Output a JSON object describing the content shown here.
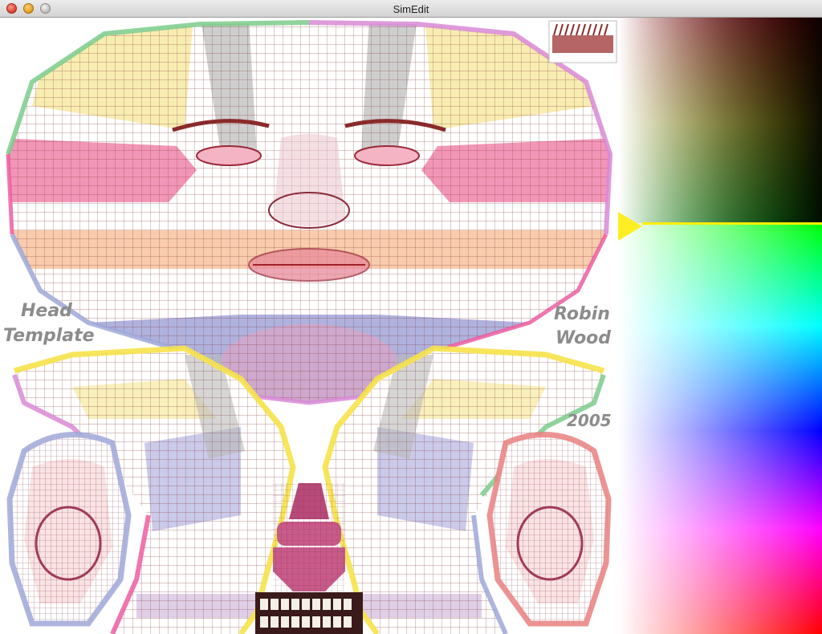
{
  "window": {
    "title": "SimEdit"
  },
  "texture_labels": {
    "head": "Head",
    "template": "Template",
    "robin": "Robin",
    "wood": "Wood",
    "year": "2005"
  },
  "colors": {
    "green_outline": "#7ccd8c",
    "pink_outline": "#d98ad6",
    "blue_outline": "#9fa8d8",
    "yellow_outline": "#f6e24a",
    "red_outline": "#e98080",
    "mesh_line": "#8a3a3a",
    "picker_marker": "#ffee00"
  },
  "icons": [
    "close-button",
    "minimize-button",
    "zoom-button",
    "color-picker-marker"
  ]
}
